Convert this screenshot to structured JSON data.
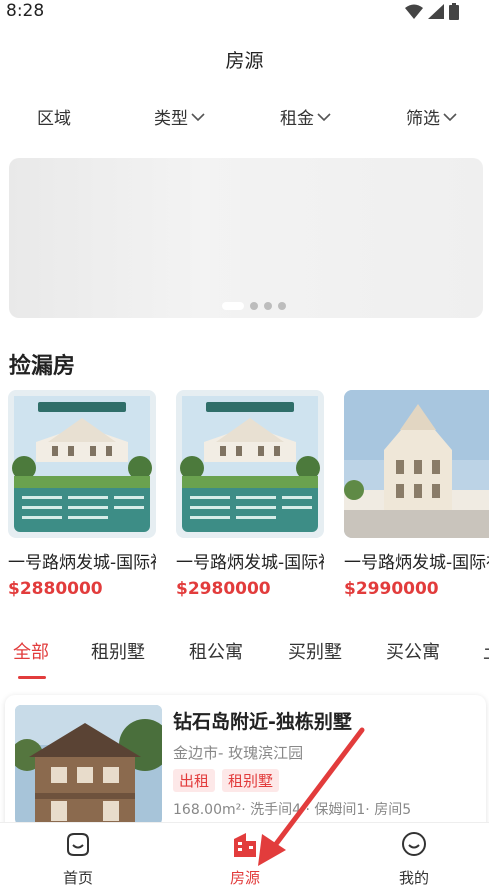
{
  "status": {
    "time": "8:28"
  },
  "header": {
    "title": "房源"
  },
  "filters": [
    "区域",
    "类型",
    "租金",
    "筛选"
  ],
  "section": {
    "title": "捡漏房"
  },
  "deals": [
    {
      "name": "一号路炳发城-国际社区",
      "price": "$2880000"
    },
    {
      "name": "一号路炳发城-国际社区",
      "price": "$2980000"
    },
    {
      "name": "一号路炳发城-国际社区",
      "price": "$2990000"
    }
  ],
  "tabs": [
    "全部",
    "租别墅",
    "租公寓",
    "买别墅",
    "买公寓",
    "土"
  ],
  "listing": {
    "title": "钻石岛附近-独栋别墅",
    "location": "金边市- 玫瑰滨江园",
    "tags": [
      "出租",
      "租别墅"
    ],
    "meta": "168.00m²· 洗手间4 · 保姆间1· 房间5"
  },
  "nav": [
    {
      "label": "首页",
      "icon": "home-smile-icon"
    },
    {
      "label": "房源",
      "icon": "building-icon"
    },
    {
      "label": "我的",
      "icon": "profile-smile-icon"
    }
  ],
  "colors": {
    "accent": "#e23c3c"
  }
}
